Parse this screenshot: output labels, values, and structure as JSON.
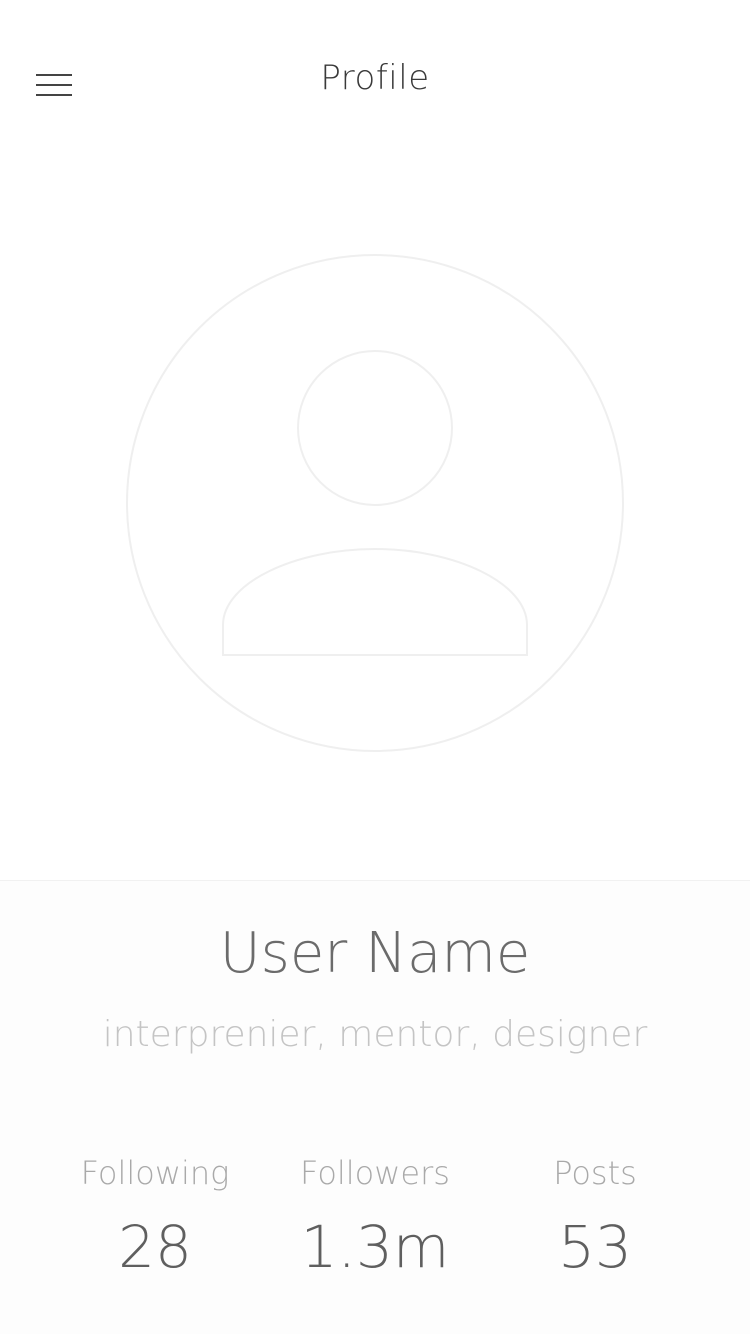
{
  "header": {
    "title": "Profile",
    "menu_icon": "hamburger-menu-icon"
  },
  "avatar": {
    "icon": "user-placeholder-icon",
    "stroke_color": "#efefef"
  },
  "profile": {
    "name": "User Name",
    "bio": "interprenier, mentor, designer"
  },
  "stats": [
    {
      "label": "Following",
      "value": "28"
    },
    {
      "label": "Followers",
      "value": "1.3m"
    },
    {
      "label": "Posts",
      "value": "53"
    }
  ],
  "colors": {
    "background": "#ffffff",
    "title_text": "#3a3a3a",
    "name_text": "#6b6b6b",
    "bio_text": "#c4c4c4",
    "stat_label": "#a9a9a9",
    "stat_value": "#5f5f5f"
  }
}
